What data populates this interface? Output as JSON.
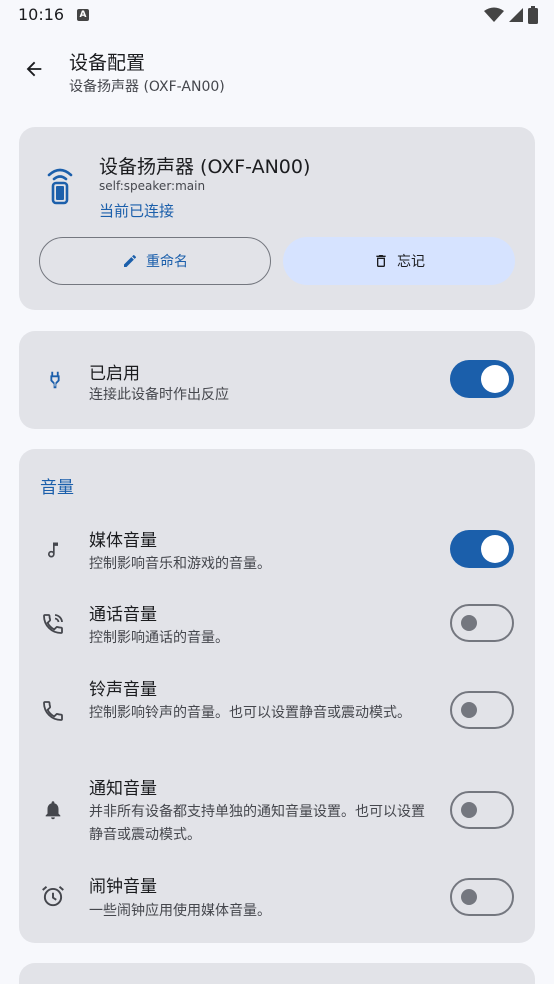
{
  "status_bar": {
    "time": "10:16",
    "notif_glyph": "A"
  },
  "app_bar": {
    "title": "设备配置",
    "subtitle": "设备扬声器 (OXF-AN00)"
  },
  "device": {
    "name": "设备扬声器 (OXF-AN00)",
    "id": "self:speaker:main",
    "status": "当前已连接",
    "rename_label": "重命名",
    "forget_label": "忘记"
  },
  "enabled": {
    "title": "已启用",
    "desc": "连接此设备时作出反应",
    "on": true
  },
  "volume": {
    "section_title": "音量",
    "items": [
      {
        "title": "媒体音量",
        "desc": "控制影响音乐和游戏的音量。",
        "on": true,
        "icon": "music-note-icon"
      },
      {
        "title": "通话音量",
        "desc": "控制影响通话的音量。",
        "on": false,
        "icon": "phone-in-talk-icon"
      },
      {
        "title": "铃声音量",
        "desc": "控制影响铃声的音量。也可以设置静音或震动模式。",
        "on": false,
        "icon": "phone-icon"
      },
      {
        "title": "通知音量",
        "desc": "并非所有设备都支持单独的通知音量设置。也可以设置静音或震动模式。",
        "on": false,
        "icon": "bell-icon"
      },
      {
        "title": "闹钟音量",
        "desc": "一些闹钟应用使用媒体音量。",
        "on": false,
        "icon": "alarm-icon"
      }
    ]
  },
  "colors": {
    "accent": "#1b5fab",
    "card": "#e2e3e8",
    "tonal": "#d6e3ff",
    "background": "#f7f8fc"
  }
}
